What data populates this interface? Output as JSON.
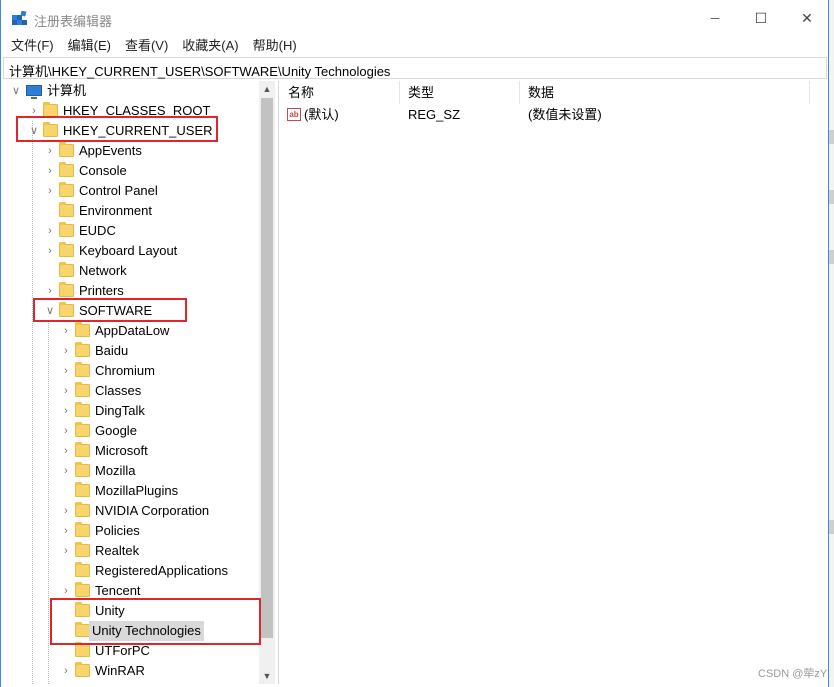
{
  "window": {
    "title": "注册表编辑器",
    "controls": {
      "minimize": "─",
      "maximize": "☐",
      "close": "✕"
    }
  },
  "menu": [
    {
      "label": "文件(F)"
    },
    {
      "label": "编辑(E)"
    },
    {
      "label": "查看(V)"
    },
    {
      "label": "收藏夹(A)"
    },
    {
      "label": "帮助(H)"
    }
  ],
  "address": "计算机\\HKEY_CURRENT_USER\\SOFTWARE\\Unity Technologies",
  "tree": {
    "root": "计算机",
    "hives": [
      {
        "label": "HKEY_CLASSES_ROOT"
      },
      {
        "label": "HKEY_CURRENT_USER"
      }
    ],
    "hkcu_children": [
      "AppEvents",
      "Console",
      "Control Panel",
      "Environment",
      "EUDC",
      "Keyboard Layout",
      "Network",
      "Printers",
      "SOFTWARE"
    ],
    "software_children": [
      "AppDataLow",
      "Baidu",
      "Chromium",
      "Classes",
      "DingTalk",
      "Google",
      "Microsoft",
      "Mozilla",
      "MozillaPlugins",
      "NVIDIA Corporation",
      "Policies",
      "Realtek",
      "RegisteredApplications",
      "Tencent",
      "Unity",
      "Unity Technologies",
      "UTForPC",
      "WinRAR"
    ],
    "selected": "Unity Technologies"
  },
  "list": {
    "columns": [
      "名称",
      "类型",
      "数据"
    ],
    "rows": [
      {
        "name": "(默认)",
        "type": "REG_SZ",
        "data": "(数值未设置)"
      }
    ]
  },
  "watermark": "CSDN @荦zY",
  "colors": {
    "highlight_box": "#e0262c",
    "folder": "#f7d56a",
    "selection": "#d9d9d9"
  }
}
